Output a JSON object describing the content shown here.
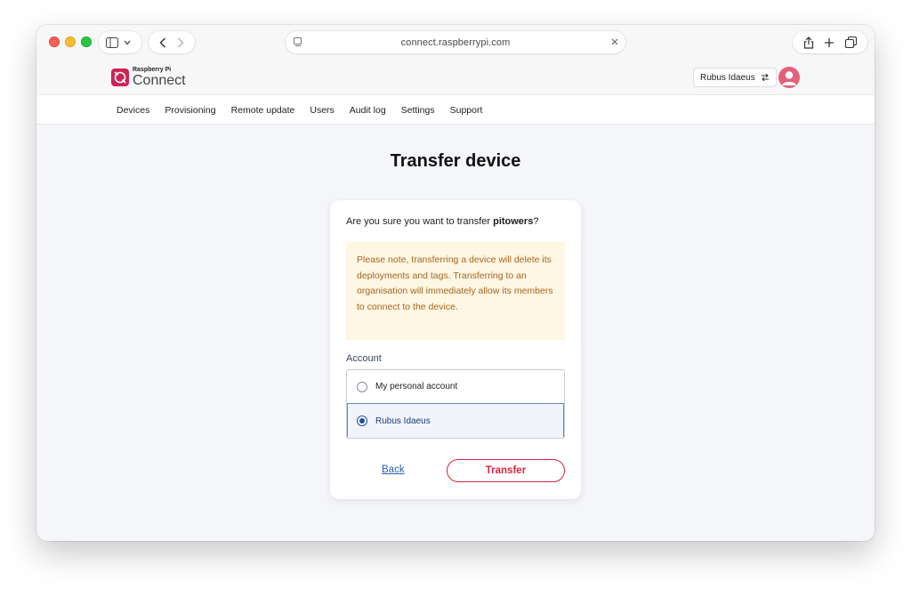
{
  "browser": {
    "url": "connect.raspberrypi.com"
  },
  "header": {
    "logo_small": "Raspberry Pi",
    "logo_big": "Connect",
    "account_switcher_label": "Rubus Idaeus"
  },
  "nav": {
    "items": [
      "Devices",
      "Provisioning",
      "Remote update",
      "Users",
      "Audit log",
      "Settings",
      "Support"
    ]
  },
  "page": {
    "title": "Transfer device"
  },
  "dialog": {
    "question_prefix": "Are you sure you want to transfer ",
    "device_name": "pitowers",
    "question_suffix": "?",
    "notice": "Please note, transferring a device will delete its deployments and tags. Transferring to an organisation will immediately allow its members to connect to the device.",
    "account_label": "Account",
    "options": [
      {
        "label": "My personal account",
        "selected": false
      },
      {
        "label": "Rubus Idaeus",
        "selected": true
      }
    ],
    "back_label": "Back",
    "transfer_label": "Transfer"
  },
  "colors": {
    "brand": "#cd2355",
    "accent_red": "#d9253f",
    "link_blue": "#2a5db5",
    "notice_bg": "#fdf7e3",
    "notice_text": "#a7651f"
  }
}
